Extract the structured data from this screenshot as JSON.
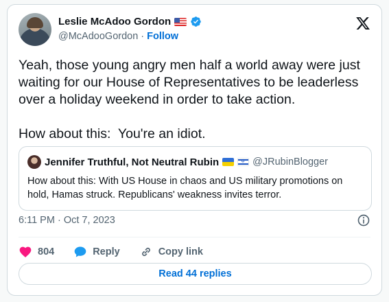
{
  "author": {
    "name": "Leslie McAdoo Gordon",
    "handle": "@McAdooGordon",
    "separator": "·",
    "follow_label": "Follow"
  },
  "tweet": {
    "paragraph1": "Yeah, those young angry men half a world away were just waiting for our House of Representatives to be leaderless over a holiday weekend in order to take action.",
    "paragraph2": "How about this:  You're an idiot.",
    "time": "6:11 PM",
    "date_sep": "·",
    "date": "Oct 7, 2023"
  },
  "quoted": {
    "name": "Jennifer Truthful, Not Neutral Rubin",
    "handle": "@JRubinBlogger",
    "text": "How about this: With US House in chaos and US military promotions on hold, Hamas struck. Republicans' weakness invites terror."
  },
  "actions": {
    "like_count": "804",
    "reply_label": "Reply",
    "copy_link_label": "Copy link"
  },
  "read_replies_label": "Read 44 replies",
  "colors": {
    "link_blue": "#006fd6",
    "like_red": "#f91880",
    "reply_blue": "#1d9bf0",
    "verified_blue": "#1d9bf0"
  }
}
